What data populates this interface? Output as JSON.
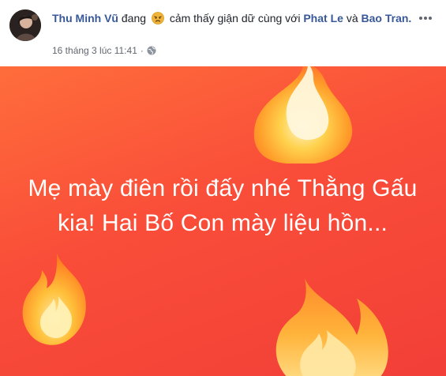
{
  "post": {
    "author": "Thu Minh Vũ",
    "feeling_prefix": "đang",
    "feeling_text": "cảm thấy giận dữ cùng với",
    "tagged_1": "Phat Le",
    "and_word": "và",
    "tagged_2": "Bao Tran.",
    "timestamp": "16 tháng 3 lúc 11:41",
    "separator": "·",
    "privacy_icon": "globe-icon",
    "more_icon": "more-icon",
    "feeling_icon": "angry-face-icon"
  },
  "status": {
    "text": "Mẹ mày điên rồi đấy nhé Thằng Gấu kia! Hai Bố Con mày liệu hồn..."
  },
  "colors": {
    "link": "#385898",
    "meta": "#616770",
    "background_top": "#ff6d3b",
    "background_bottom": "#f23f38",
    "status_text": "#ffffff"
  }
}
